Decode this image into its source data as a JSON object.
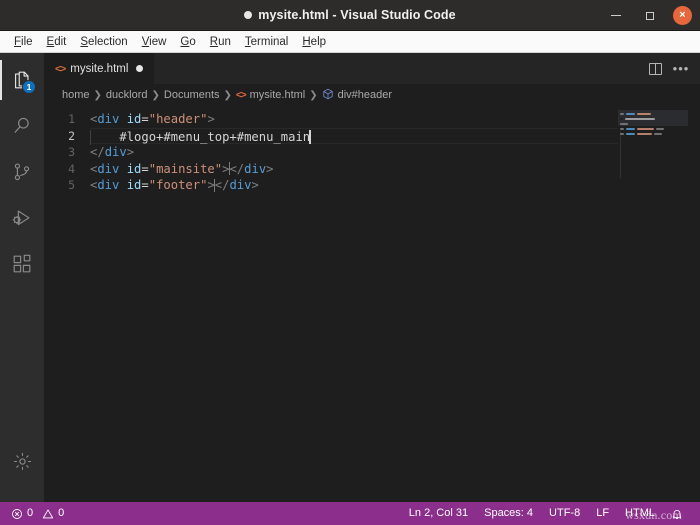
{
  "window": {
    "title": "mysite.html - Visual Studio Code",
    "dirty_marker": "●",
    "controls": {
      "minimize": "minimize-button",
      "maximize": "maximize-button",
      "close": "×"
    }
  },
  "menubar": {
    "items": [
      {
        "mnemonic": "F",
        "rest": "ile"
      },
      {
        "mnemonic": "E",
        "rest": "dit"
      },
      {
        "mnemonic": "S",
        "rest": "election"
      },
      {
        "mnemonic": "V",
        "rest": "iew"
      },
      {
        "mnemonic": "G",
        "rest": "o"
      },
      {
        "mnemonic": "R",
        "rest": "un"
      },
      {
        "mnemonic": "T",
        "rest": "erminal"
      },
      {
        "mnemonic": "H",
        "rest": "elp"
      }
    ]
  },
  "activitybar": {
    "items": [
      {
        "name": "explorer",
        "icon": "files-icon",
        "badge": "1",
        "active": true
      },
      {
        "name": "search",
        "icon": "search-icon",
        "badge": "",
        "active": false
      },
      {
        "name": "source-control",
        "icon": "source-control-icon",
        "badge": "",
        "active": false
      },
      {
        "name": "run-and-debug",
        "icon": "run-debug-icon",
        "badge": "",
        "active": false
      },
      {
        "name": "extensions",
        "icon": "extensions-icon",
        "badge": "",
        "active": false
      }
    ],
    "manage": {
      "name": "manage",
      "icon": "gear-icon"
    }
  },
  "tabs": [
    {
      "icon": "html-file-icon",
      "icon_glyph": "<>",
      "label": "mysite.html",
      "dirty": true,
      "active": true
    }
  ],
  "editor_actions": {
    "split": "split-editor-icon",
    "more": "•••"
  },
  "breadcrumbs": [
    {
      "label": "home",
      "icon": ""
    },
    {
      "label": "ducklord",
      "icon": ""
    },
    {
      "label": "Documents",
      "icon": ""
    },
    {
      "label": "mysite.html",
      "icon": "html-file-icon",
      "icon_glyph": "<>"
    },
    {
      "label": "div#header",
      "icon": "symbol-module-icon"
    }
  ],
  "breadcrumb_separator": "❯",
  "code": {
    "language": "HTML",
    "lines": [
      {
        "number": "1",
        "current": false,
        "indent_guide": false,
        "tokens": [
          {
            "t": "punct",
            "v": "<"
          },
          {
            "t": "tag",
            "v": "div"
          },
          {
            "t": "text",
            "v": " "
          },
          {
            "t": "attr",
            "v": "id"
          },
          {
            "t": "eq",
            "v": "="
          },
          {
            "t": "str",
            "v": "\"header\""
          },
          {
            "t": "punct",
            "v": ">"
          }
        ]
      },
      {
        "number": "2",
        "current": true,
        "indent_guide": true,
        "tokens": [
          {
            "t": "text",
            "v": "    #logo+#menu_top+#menu_main"
          },
          {
            "t": "caret",
            "v": ""
          }
        ]
      },
      {
        "number": "3",
        "current": false,
        "indent_guide": false,
        "tokens": [
          {
            "t": "punct",
            "v": "</"
          },
          {
            "t": "tag",
            "v": "div"
          },
          {
            "t": "punct",
            "v": ">"
          }
        ]
      },
      {
        "number": "4",
        "current": false,
        "indent_guide": false,
        "tokens": [
          {
            "t": "punct",
            "v": "<"
          },
          {
            "t": "tag",
            "v": "div"
          },
          {
            "t": "text",
            "v": " "
          },
          {
            "t": "attr",
            "v": "id"
          },
          {
            "t": "eq",
            "v": "="
          },
          {
            "t": "str",
            "v": "\"mainsite\""
          },
          {
            "t": "punct",
            "v": ">"
          },
          {
            "t": "caret-thin",
            "v": ""
          },
          {
            "t": "punct",
            "v": "</"
          },
          {
            "t": "tag",
            "v": "div"
          },
          {
            "t": "punct",
            "v": ">"
          }
        ]
      },
      {
        "number": "5",
        "current": false,
        "indent_guide": false,
        "tokens": [
          {
            "t": "punct",
            "v": "<"
          },
          {
            "t": "tag",
            "v": "div"
          },
          {
            "t": "text",
            "v": " "
          },
          {
            "t": "attr",
            "v": "id"
          },
          {
            "t": "eq",
            "v": "="
          },
          {
            "t": "str",
            "v": "\"footer\""
          },
          {
            "t": "punct",
            "v": ">"
          },
          {
            "t": "caret-thin",
            "v": ""
          },
          {
            "t": "punct",
            "v": "</"
          },
          {
            "t": "tag",
            "v": "div"
          },
          {
            "t": "punct",
            "v": ">"
          }
        ]
      }
    ]
  },
  "minimap": {
    "lines": [
      [
        {
          "w": 4,
          "c": "#808080"
        },
        {
          "w": 9,
          "c": "#569cd6"
        },
        {
          "w": 14,
          "c": "#ce9178"
        }
      ],
      [
        {
          "w": 3,
          "c": "#1e1e1e"
        },
        {
          "w": 30,
          "c": "#b0b0b0"
        }
      ],
      [
        {
          "w": 8,
          "c": "#808080"
        }
      ],
      [
        {
          "w": 4,
          "c": "#808080"
        },
        {
          "w": 9,
          "c": "#569cd6"
        },
        {
          "w": 17,
          "c": "#ce9178"
        },
        {
          "w": 8,
          "c": "#808080"
        }
      ],
      [
        {
          "w": 4,
          "c": "#808080"
        },
        {
          "w": 9,
          "c": "#569cd6"
        },
        {
          "w": 15,
          "c": "#ce9178"
        },
        {
          "w": 8,
          "c": "#808080"
        }
      ]
    ]
  },
  "statusbar": {
    "left": [
      {
        "name": "problems",
        "icon": "error-icon",
        "errors": "0",
        "warn_icon": "warning-icon",
        "warnings": "0"
      }
    ],
    "errors": "0",
    "warnings": "0",
    "right": [
      {
        "name": "editor-position",
        "label": "Ln 2, Col 31"
      },
      {
        "name": "editor-indentation",
        "label": "Spaces: 4"
      },
      {
        "name": "editor-encoding",
        "label": "UTF-8"
      },
      {
        "name": "editor-eol",
        "label": "LF"
      },
      {
        "name": "editor-language",
        "label": "HTML"
      },
      {
        "name": "notifications",
        "label": "",
        "icon": "bell-icon"
      }
    ]
  },
  "watermark": "wsxdn.com",
  "colors": {
    "titlebar": "#2e2c2b",
    "menubar": "#fbfafa",
    "activitybar": "#2d2d2d",
    "editor": "#1e1e1e",
    "statusbar": "#8c2f8c",
    "badge": "#0e70c0",
    "close_button": "#e8663c",
    "tag": "#569cd6",
    "attr": "#9cdcfe",
    "string": "#ce9178"
  }
}
